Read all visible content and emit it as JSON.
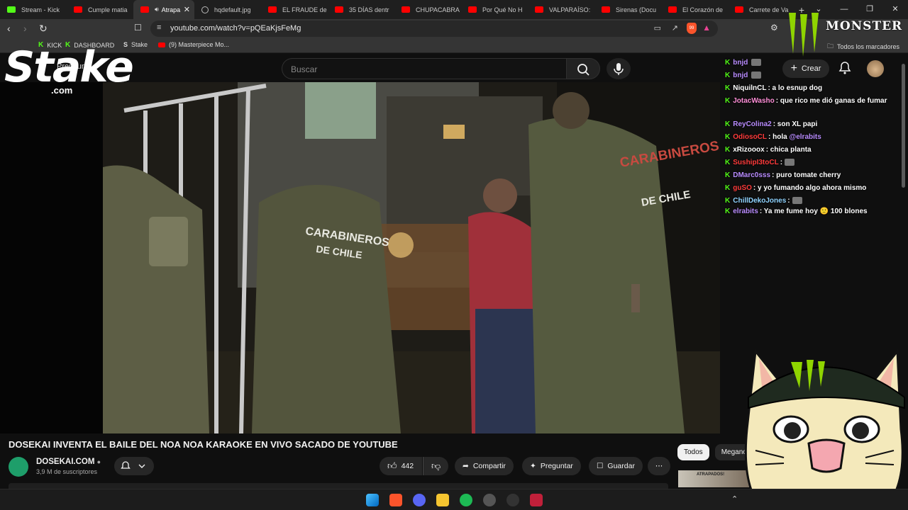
{
  "tabs": [
    {
      "title": "Stream - Kick",
      "icon": "kick"
    },
    {
      "title": "Cumple matia",
      "icon": "youtube"
    },
    {
      "title": "Atrapa",
      "icon": "youtube",
      "active": true
    },
    {
      "title": "hqdefault.jpg",
      "icon": "globe"
    },
    {
      "title": "EL FRAUDE de",
      "icon": "youtube"
    },
    {
      "title": "35 DÍAS dentr",
      "icon": "youtube"
    },
    {
      "title": "CHUPACABRA",
      "icon": "youtube"
    },
    {
      "title": "Por Qué No H",
      "icon": "youtube"
    },
    {
      "title": "VALPARAÍSO:",
      "icon": "youtube"
    },
    {
      "title": "Sirenas (Docu",
      "icon": "youtube"
    },
    {
      "title": "El Corazón de",
      "icon": "youtube"
    },
    {
      "title": "Carrete de Va",
      "icon": "youtube"
    }
  ],
  "browser": {
    "url": "youtube.com/watch?v=pQEaKjsFeMg",
    "shield_count": "99"
  },
  "bookmarks": [
    {
      "label": "KICK",
      "icon": "kick"
    },
    {
      "label": "DASHBOARD",
      "icon": "kick"
    },
    {
      "label": "Stake",
      "icon": "stake"
    },
    {
      "label": "(9) Masterpiece Mo...",
      "icon": "youtube"
    }
  ],
  "all_bookmarks_label": "Todos los marcadores",
  "youtube": {
    "logo_text": "Premium",
    "search_placeholder": "Buscar",
    "create_label": "Crear",
    "video_title": "DOSEKAI INVENTA EL BAILE DEL NOA NOA KARAOKE EN VIVO SACADO DE YOUTUBE",
    "channel_name": "DOSEKAI.COM",
    "subscribers": "3,9 M de suscriptores",
    "likes": "442",
    "share_label": "Compartir",
    "ask_label": "Preguntar",
    "save_label": "Guardar",
    "chips": [
      "Todos",
      "Meganot"
    ],
    "thumb_label": "ATRAPADOS!"
  },
  "scene_text": {
    "vest_left": "CARABINEROS",
    "vest_left_sub": "DE CHILE",
    "vest_right": "CARABINEROS",
    "vest_right_sub": "DE CHILE"
  },
  "chat": [
    {
      "user": "bnjd",
      "message": "",
      "color": "#b98cff",
      "emote": true
    },
    {
      "user": "bnjd",
      "message": "",
      "color": "#b98cff",
      "emote": true
    },
    {
      "user": "NiquilnCL",
      "message": ": a lo esnup dog",
      "color": "#ffffff"
    },
    {
      "user": "JotacWasho",
      "message": ": que rico me dió ganas de fumar",
      "color": "#ff8fd8"
    },
    {
      "user": "ReyColina2",
      "message": ": son XL papi",
      "color": "#b98cff"
    },
    {
      "user": "OdiosoCL",
      "message": ": hola ",
      "mention": "@elrabits",
      "color": "#ff3b3b"
    },
    {
      "user": "xRizooox",
      "message": ": chica planta",
      "color": "#ffffff"
    },
    {
      "user": "SushipI3toCL",
      "message": ":",
      "color": "#ff3b3b",
      "emote": true
    },
    {
      "user": "DMarc0sss",
      "message": ": puro tomate cherry",
      "color": "#b98cff"
    },
    {
      "user": "guSO",
      "message": ": y yo fumando algo ahora mismo",
      "color": "#ff3b3b"
    },
    {
      "user": "ChillDekoJones",
      "message": ":",
      "color": "#8fd3ff",
      "emote": true
    },
    {
      "user": "elrabits",
      "message": ": Ya me fume hoy 🙂 100 blones",
      "color": "#b98cff"
    }
  ],
  "overlays": {
    "stake_text": "Stake",
    "stake_com": ".com",
    "monster_text": "MONSTER"
  },
  "colors": {
    "kick_green": "#53fc18",
    "youtube_red": "#ff0000",
    "page_bg": "#0f0f0f"
  }
}
